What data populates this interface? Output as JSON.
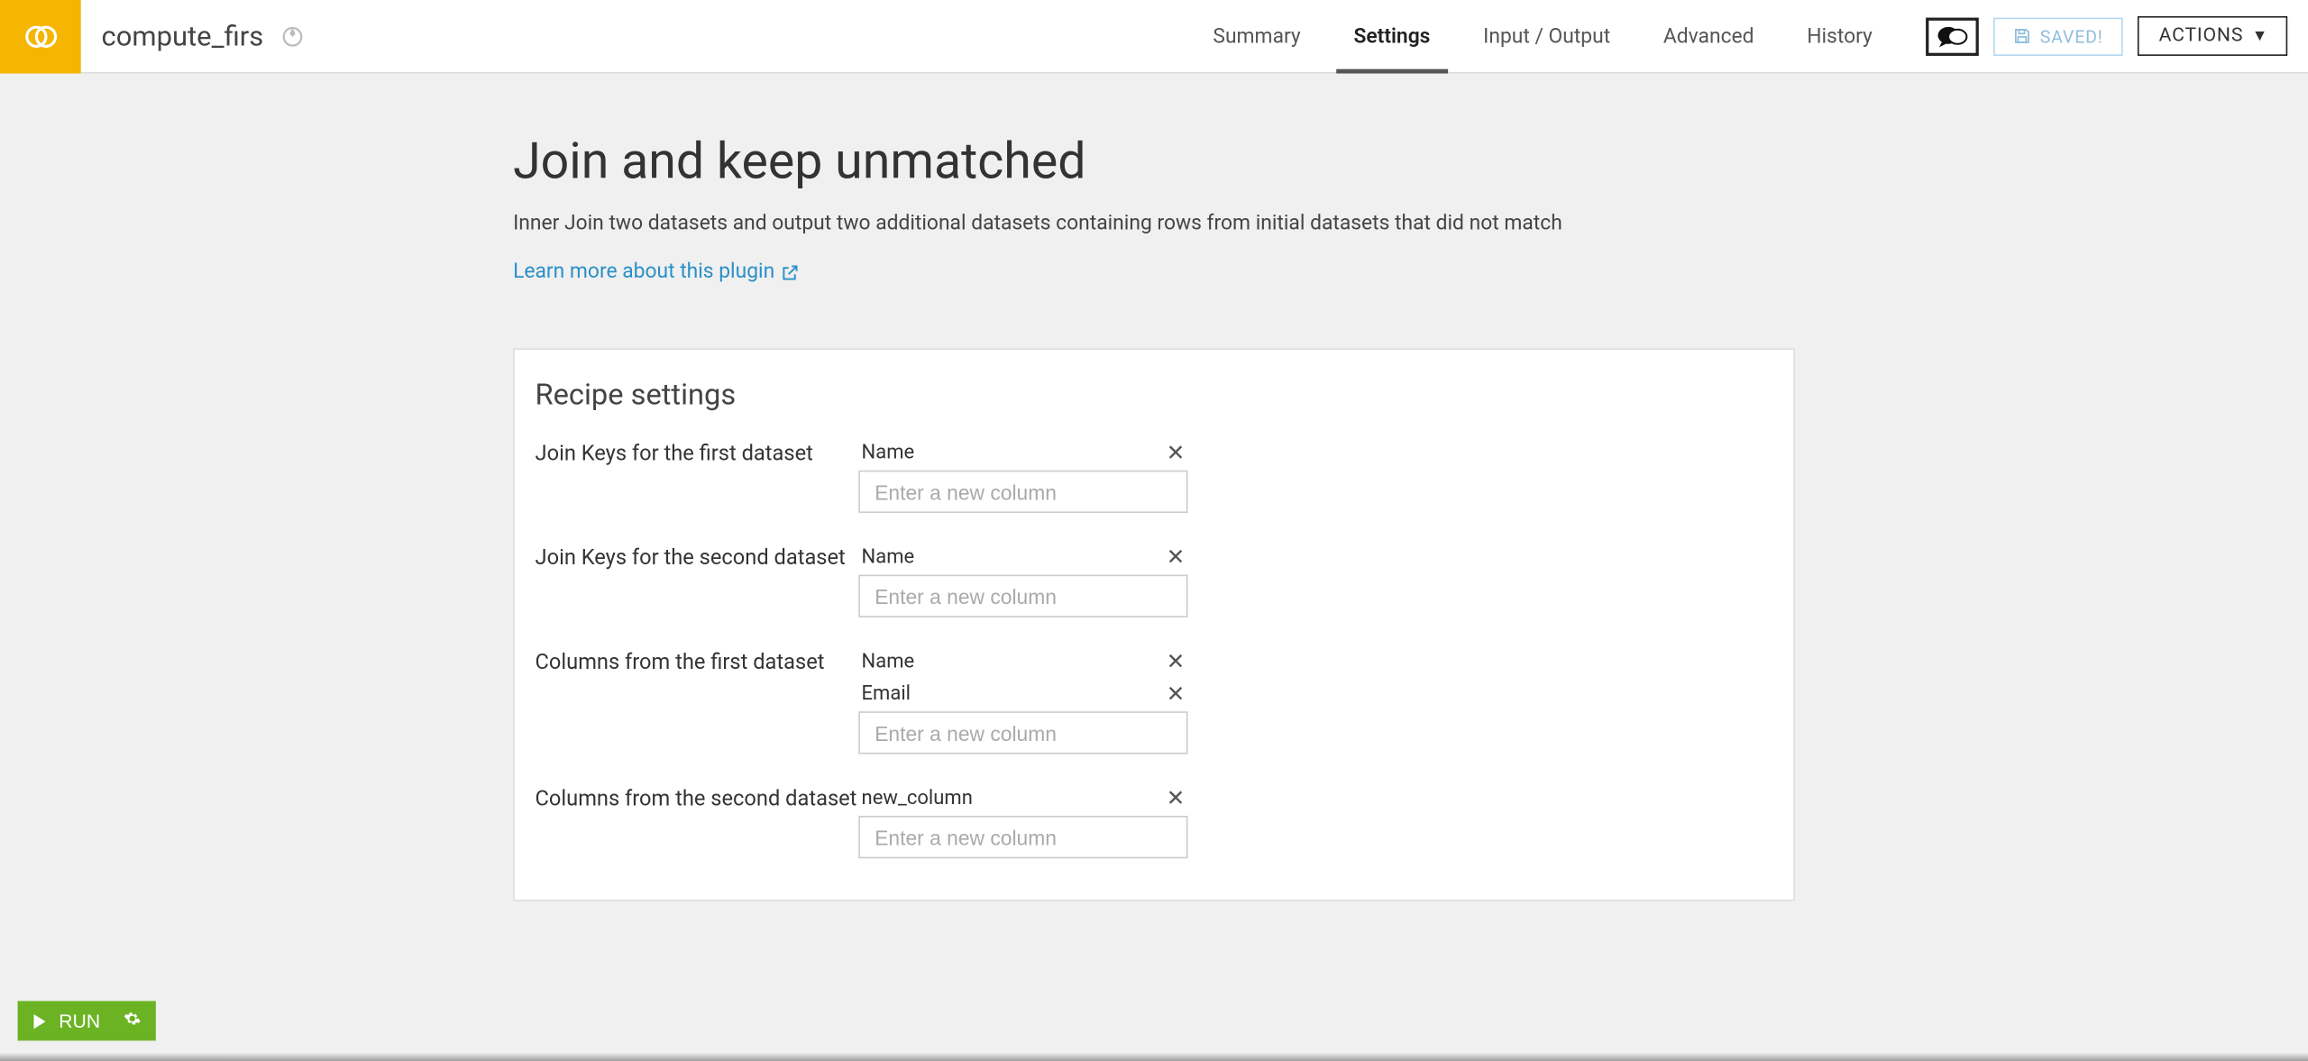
{
  "header": {
    "title": "compute_firs",
    "tabs": [
      "Summary",
      "Settings",
      "Input / Output",
      "Advanced",
      "History"
    ],
    "active_tab_index": 1,
    "saved_label": "SAVED!",
    "actions_label": "ACTIONS"
  },
  "page": {
    "heading": "Join and keep unmatched",
    "description": "Inner Join two datasets and output two additional datasets containing rows from initial datasets that did not match",
    "learn_link": "Learn more about this plugin"
  },
  "panel": {
    "title": "Recipe settings",
    "input_placeholder": "Enter a new column",
    "rows": [
      {
        "label": "Join Keys for the first dataset",
        "values": [
          "Name"
        ]
      },
      {
        "label": "Join Keys for the second dataset",
        "values": [
          "Name"
        ]
      },
      {
        "label": "Columns from the first dataset",
        "values": [
          "Name",
          "Email"
        ]
      },
      {
        "label": "Columns from the second dataset",
        "values": [
          "new_column"
        ]
      }
    ]
  },
  "footer": {
    "run_label": "RUN"
  }
}
